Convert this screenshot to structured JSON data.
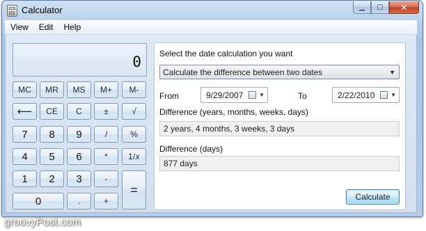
{
  "window": {
    "title": "Calculator"
  },
  "menu": {
    "items": [
      "View",
      "Edit",
      "Help"
    ]
  },
  "display": {
    "value": "0"
  },
  "keypad": {
    "mc": "MC",
    "mr": "MR",
    "ms": "MS",
    "mplus": "M+",
    "mminus": "M-",
    "back": "⟵",
    "ce": "CE",
    "c": "C",
    "sign": "±",
    "sqrt": "√",
    "n7": "7",
    "n8": "8",
    "n9": "9",
    "div": "/",
    "pct": "%",
    "n4": "4",
    "n5": "5",
    "n6": "6",
    "mul": "*",
    "recip": "1/𝑥",
    "n1": "1",
    "n2": "2",
    "n3": "3",
    "sub": "-",
    "eq": "=",
    "n0": "0",
    "dot": ".",
    "add": "+"
  },
  "date_panel": {
    "prompt": "Select the date calculation you want",
    "mode": "Calculate the difference between two dates",
    "from_label": "From",
    "from_date": "9/29/2007",
    "to_label": "To",
    "to_date": "2/22/2010",
    "diff_ymwd_label": "Difference (years, months, weeks, days)",
    "diff_ymwd_value": "2 years, 4 months, 3 weeks, 3 days",
    "diff_days_label": "Difference (days)",
    "diff_days_value": "877 days",
    "calculate_label": "Calculate"
  },
  "watermark": "groovyPost.com"
}
